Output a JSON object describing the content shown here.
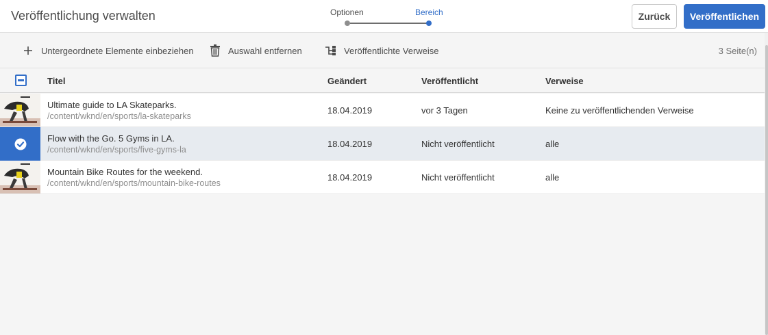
{
  "header": {
    "title": "Veröffentlichung verwalten",
    "steps": [
      {
        "label": "Optionen",
        "state": "completed"
      },
      {
        "label": "Bereich",
        "state": "active"
      }
    ],
    "back_label": "Zurück",
    "publish_label": "Veröffentlichen"
  },
  "actionbar": {
    "add_label": "Untergeordnete Elemente einbeziehen",
    "remove_label": "Auswahl entfernen",
    "refs_label": "Veröffentlichte Verweise",
    "page_count": "3 Seite(n)"
  },
  "table": {
    "columns": [
      "Titel",
      "Geändert",
      "Veröffentlicht",
      "Verweise"
    ],
    "rows": [
      {
        "title": "Ultimate guide to LA Skateparks.",
        "path": "/content/wknd/en/sports/la-skateparks",
        "modified": "18.04.2019",
        "published": "vor 3 Tagen",
        "references": "Keine zu veröffentlichenden Verweise",
        "selected": false
      },
      {
        "title": "Flow with the Go. 5 Gyms in LA.",
        "path": "/content/wknd/en/sports/five-gyms-la",
        "modified": "18.04.2019",
        "published": "Nicht veröffentlicht",
        "references": "alle",
        "selected": true
      },
      {
        "title": "Mountain Bike Routes for the weekend.",
        "path": "/content/wknd/en/sports/mountain-bike-routes",
        "modified": "18.04.2019",
        "published": "Nicht veröffentlicht",
        "references": "alle",
        "selected": false
      }
    ]
  },
  "colors": {
    "accent": "#326ec8",
    "selected_row": "#e7ebf0",
    "background": "#f5f5f5"
  },
  "icons": [
    "add-icon",
    "trash-icon",
    "references-icon",
    "checkmark-icon",
    "minus-checkbox-icon"
  ]
}
